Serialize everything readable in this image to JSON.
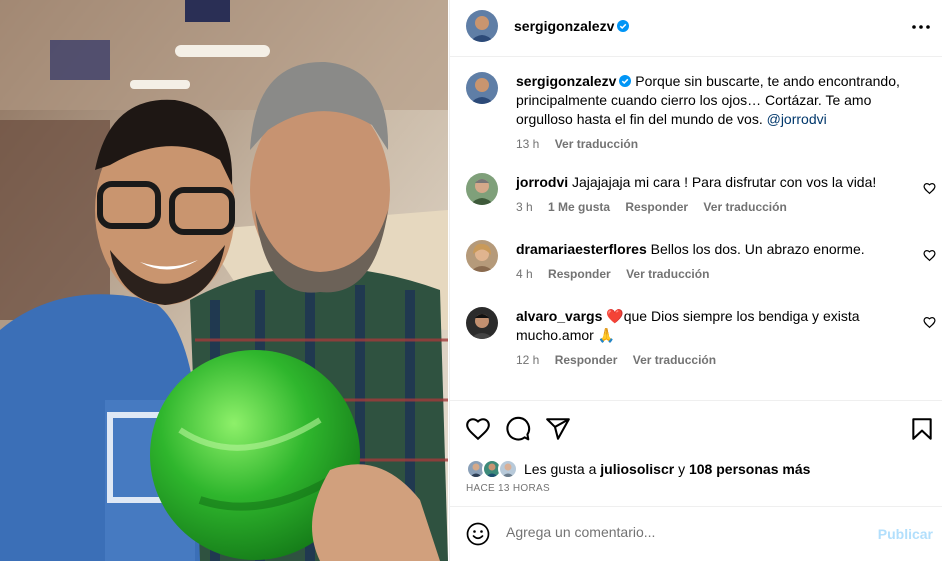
{
  "post": {
    "author": "sergigonzalezv",
    "verified": true
  },
  "caption": {
    "username": "sergigonzalezv",
    "text": "Porque sin buscarte, te ando encontrando, principalmente cuando cierro los ojos… Cortázar. Te amo orgulloso hasta el fin del mundo de vos.",
    "mention": "@jorrodvi",
    "time": "13 h",
    "translate": "Ver traducción"
  },
  "comments": [
    {
      "username": "jorrodvi",
      "text": "Jajajajaja mi cara ! Para disfrutar con vos la vida!",
      "time": "3 h",
      "likes": "1 Me gusta",
      "reply": "Responder",
      "translate": "Ver traducción"
    },
    {
      "username": "dramariaesterflores",
      "text": "Bellos los dos. Un abrazo enorme.",
      "time": "4 h",
      "reply": "Responder",
      "translate": "Ver traducción"
    },
    {
      "username": "alvaro_vargs",
      "text": "❤️que Dios siempre los bendiga y exista mucho.amor 🙏",
      "time": "12 h",
      "reply": "Responder",
      "translate": "Ver traducción"
    }
  ],
  "likes": {
    "prefix": "Les gusta a",
    "user": "juliosoliscr",
    "joiner": "y",
    "others": "108 personas más"
  },
  "timeago": "HACE 13 HORAS",
  "compose": {
    "placeholder": "Agrega un comentario...",
    "publish": "Publicar"
  },
  "icons": {
    "like": "heart-icon",
    "comment": "comment-icon",
    "share": "send-icon",
    "save": "bookmark-icon",
    "emoji": "emoji-icon",
    "more": "more-icon",
    "verified": "verified-badge-icon"
  },
  "colors": {
    "verified": "#0095f6",
    "muted": "#737373",
    "mention": "#00376b",
    "publish_disabled": "#b2dffc"
  }
}
